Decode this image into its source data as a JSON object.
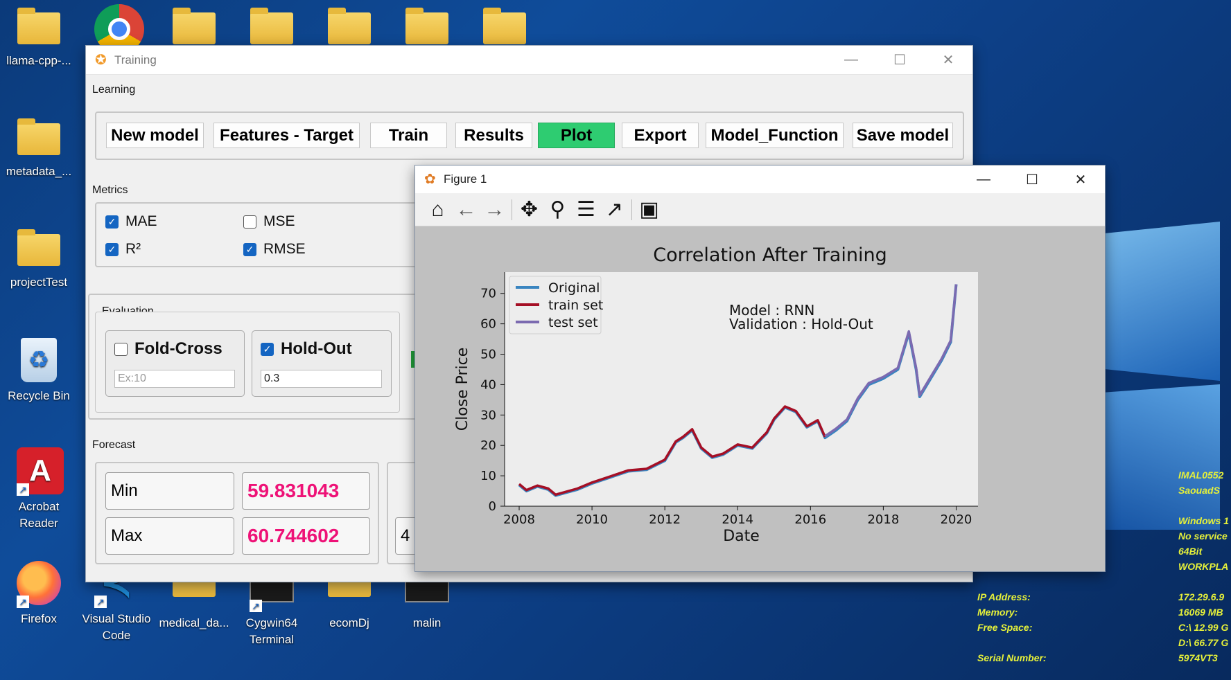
{
  "desktop": {
    "icons": [
      {
        "label": "llama-cpp-...",
        "type": "folder"
      },
      {
        "label": "",
        "type": "chrome"
      },
      {
        "label": "",
        "type": "folder"
      },
      {
        "label": "",
        "type": "folder"
      },
      {
        "label": "",
        "type": "folder"
      },
      {
        "label": "",
        "type": "folder"
      },
      {
        "label": "",
        "type": "folder"
      },
      {
        "label": "metadata_...",
        "type": "folder"
      },
      {
        "label": "projectTest",
        "type": "folder"
      },
      {
        "label": "Recycle Bin",
        "type": "recycle-bin"
      },
      {
        "label": "Acrobat Reader",
        "type": "acrobat"
      },
      {
        "label": "Firefox",
        "type": "firefox"
      },
      {
        "label": "Visual Studio Code",
        "type": "vscode"
      },
      {
        "label": "medical_da...",
        "type": "folder"
      },
      {
        "label": "Cygwin64 Terminal",
        "type": "terminal"
      },
      {
        "label": "ecomDj",
        "type": "folder"
      },
      {
        "label": "malin",
        "type": "terminal"
      }
    ],
    "sysinfo": {
      "labels": [
        "IP Address:",
        "Memory:",
        "Free Space:",
        "Serial Number:"
      ],
      "values": [
        "IMAL0552",
        "SaouadS",
        "Windows 1",
        "No service",
        "64Bit",
        "WORKPLA",
        "172.29.6.9",
        "16069 MB",
        "C:\\ 12.99 G",
        "D:\\ 66.77 G",
        "5974VT3"
      ]
    }
  },
  "training_window": {
    "title": "Training",
    "learning_label": "Learning",
    "buttons": [
      "New model",
      "Features - Target",
      "Train",
      "Results",
      "Plot",
      "Export",
      "Model_Function",
      "Save model"
    ],
    "active_button": "Plot",
    "metrics_label": "Metrics",
    "metrics": [
      {
        "label": "MAE",
        "checked": true
      },
      {
        "label": "MSE",
        "checked": false
      },
      {
        "label": "R²",
        "checked": true
      },
      {
        "label": "RMSE",
        "checked": true
      }
    ],
    "evaluation_label": "Evaluation",
    "fold_cross": {
      "label": "Fold-Cross",
      "checked": false,
      "placeholder": "Ex:10",
      "value": ""
    },
    "hold_out": {
      "label": "Hold-Out",
      "checked": true,
      "value": "0.3"
    },
    "forecast_label": "Forecast",
    "forecast": {
      "min_label": "Min",
      "min_value": "59.831043",
      "max_label": "Max",
      "max_value": "60.744602",
      "partial_value": "4"
    }
  },
  "figure_window": {
    "title": "Figure 1",
    "toolbar_icons": [
      "home-icon",
      "back-arrow-icon",
      "forward-arrow-icon",
      "pan-icon",
      "zoom-icon",
      "configure-subplots-icon",
      "edit-axis-icon",
      "save-icon"
    ]
  },
  "chart_data": {
    "type": "line",
    "title": "Correlation After Training",
    "xlabel": "Date",
    "ylabel": "Close Price",
    "xlim": [
      2007.6,
      2020.6
    ],
    "ylim": [
      0,
      77
    ],
    "xticks": [
      2008,
      2010,
      2012,
      2014,
      2016,
      2018,
      2020
    ],
    "yticks": [
      0,
      10,
      20,
      30,
      40,
      50,
      60,
      70
    ],
    "legend_position": "top-left",
    "annotation": [
      "Model : RNN",
      "Validation : Hold-Out"
    ],
    "series": [
      {
        "name": "Original",
        "color": "#3a85c0",
        "x": [
          2008.0,
          2008.2,
          2008.5,
          2008.8,
          2009.0,
          2009.3,
          2009.6,
          2010.0,
          2010.5,
          2011.0,
          2011.5,
          2012.0,
          2012.3,
          2012.5,
          2012.75,
          2013.0,
          2013.3,
          2013.6,
          2014.0,
          2014.4,
          2014.8,
          2015.0,
          2015.3,
          2015.6,
          2015.9,
          2016.2,
          2016.4,
          2016.7,
          2017.0,
          2017.3,
          2017.6,
          2018.0,
          2018.4,
          2018.7,
          2018.9,
          2019.0,
          2019.3,
          2019.6,
          2019.85,
          2020.0
        ],
        "y": [
          7,
          5,
          6.5,
          5.5,
          3.5,
          4.5,
          5.5,
          7.5,
          9.5,
          11.5,
          12,
          15,
          21,
          22.5,
          25,
          19,
          16,
          17,
          20,
          19,
          24,
          28.5,
          32.5,
          31,
          26,
          28,
          22.5,
          25,
          28,
          35,
          40,
          42,
          45,
          57,
          45,
          36,
          42,
          48,
          54,
          73
        ]
      },
      {
        "name": "train set",
        "color": "#a50f25",
        "x": [
          2008.0,
          2008.2,
          2008.5,
          2008.8,
          2009.0,
          2009.3,
          2009.6,
          2010.0,
          2010.5,
          2011.0,
          2011.5,
          2012.0,
          2012.3,
          2012.5,
          2012.75,
          2013.0,
          2013.3,
          2013.6,
          2014.0,
          2014.4,
          2014.8,
          2015.0,
          2015.3,
          2015.6,
          2015.9,
          2016.2,
          2016.4
        ],
        "y": [
          7.3,
          5.3,
          6.8,
          5.8,
          3.8,
          4.8,
          5.8,
          7.8,
          9.8,
          11.8,
          12.3,
          15.3,
          21.3,
          22.8,
          25.3,
          19.3,
          16.3,
          17.3,
          20.3,
          19.3,
          24.3,
          28.8,
          32.8,
          31.3,
          26.3,
          28.3,
          22.8
        ]
      },
      {
        "name": "test set",
        "color": "#7b6ab0",
        "x": [
          2016.4,
          2016.7,
          2017.0,
          2017.3,
          2017.6,
          2018.0,
          2018.4,
          2018.7,
          2018.9,
          2019.0,
          2019.3,
          2019.6,
          2019.85,
          2020.0
        ],
        "y": [
          23,
          25.5,
          28.5,
          35.5,
          40.5,
          42.5,
          45.5,
          57.5,
          45.5,
          36.5,
          42.5,
          48.5,
          54.5,
          73
        ]
      }
    ]
  }
}
